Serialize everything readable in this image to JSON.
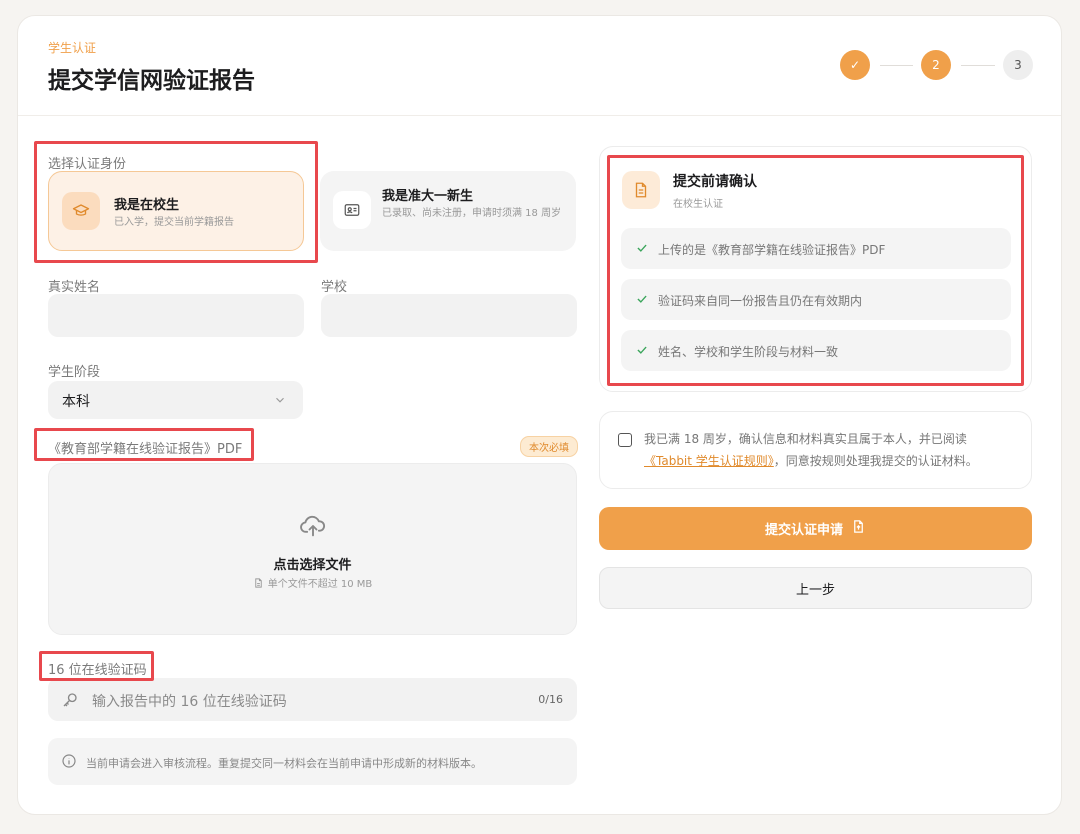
{
  "header": {
    "eyebrow": "学生认证",
    "title": "提交学信网验证报告",
    "steps": [
      "✓",
      "2",
      "3"
    ]
  },
  "identity": {
    "label": "选择认证身份",
    "options": [
      {
        "title": "我是在校生",
        "desc": "已入学，提交当前学籍报告",
        "selected": true
      },
      {
        "title": "我是准大一新生",
        "desc": "已录取、尚未注册，申请时须满 18 周岁",
        "selected": false
      }
    ]
  },
  "fields": {
    "name_label": "真实姓名",
    "school_label": "学校",
    "stage_label": "学生阶段",
    "stage_value": "本科"
  },
  "upload": {
    "label": "《教育部学籍在线验证报告》PDF",
    "badge": "本次必填",
    "title": "点击选择文件",
    "hint": "单个文件不超过 10 MB"
  },
  "code": {
    "label": "16 位在线验证码",
    "placeholder": "输入报告中的 16 位在线验证码",
    "counter": "0/16"
  },
  "notice": "当前申请会进入审核流程。重复提交同一材料会在当前申请中形成新的材料版本。",
  "confirm": {
    "title": "提交前请确认",
    "subtitle": "在校生认证",
    "items": [
      "上传的是《教育部学籍在线验证报告》PDF",
      "验证码来自同一份报告且仍在有效期内",
      "姓名、学校和学生阶段与材料一致"
    ]
  },
  "agreement": {
    "pre": "我已满 18 周岁，确认信息和材料真实且属于本人，并已阅读",
    "link": "《Tabbit 学生认证规则》",
    "post": "，同意按规则处理我提交的认证材料。"
  },
  "actions": {
    "submit": "提交认证申请",
    "back": "上一步"
  },
  "colors": {
    "accent": "#f0a04a",
    "highlight": "#e8484d"
  }
}
